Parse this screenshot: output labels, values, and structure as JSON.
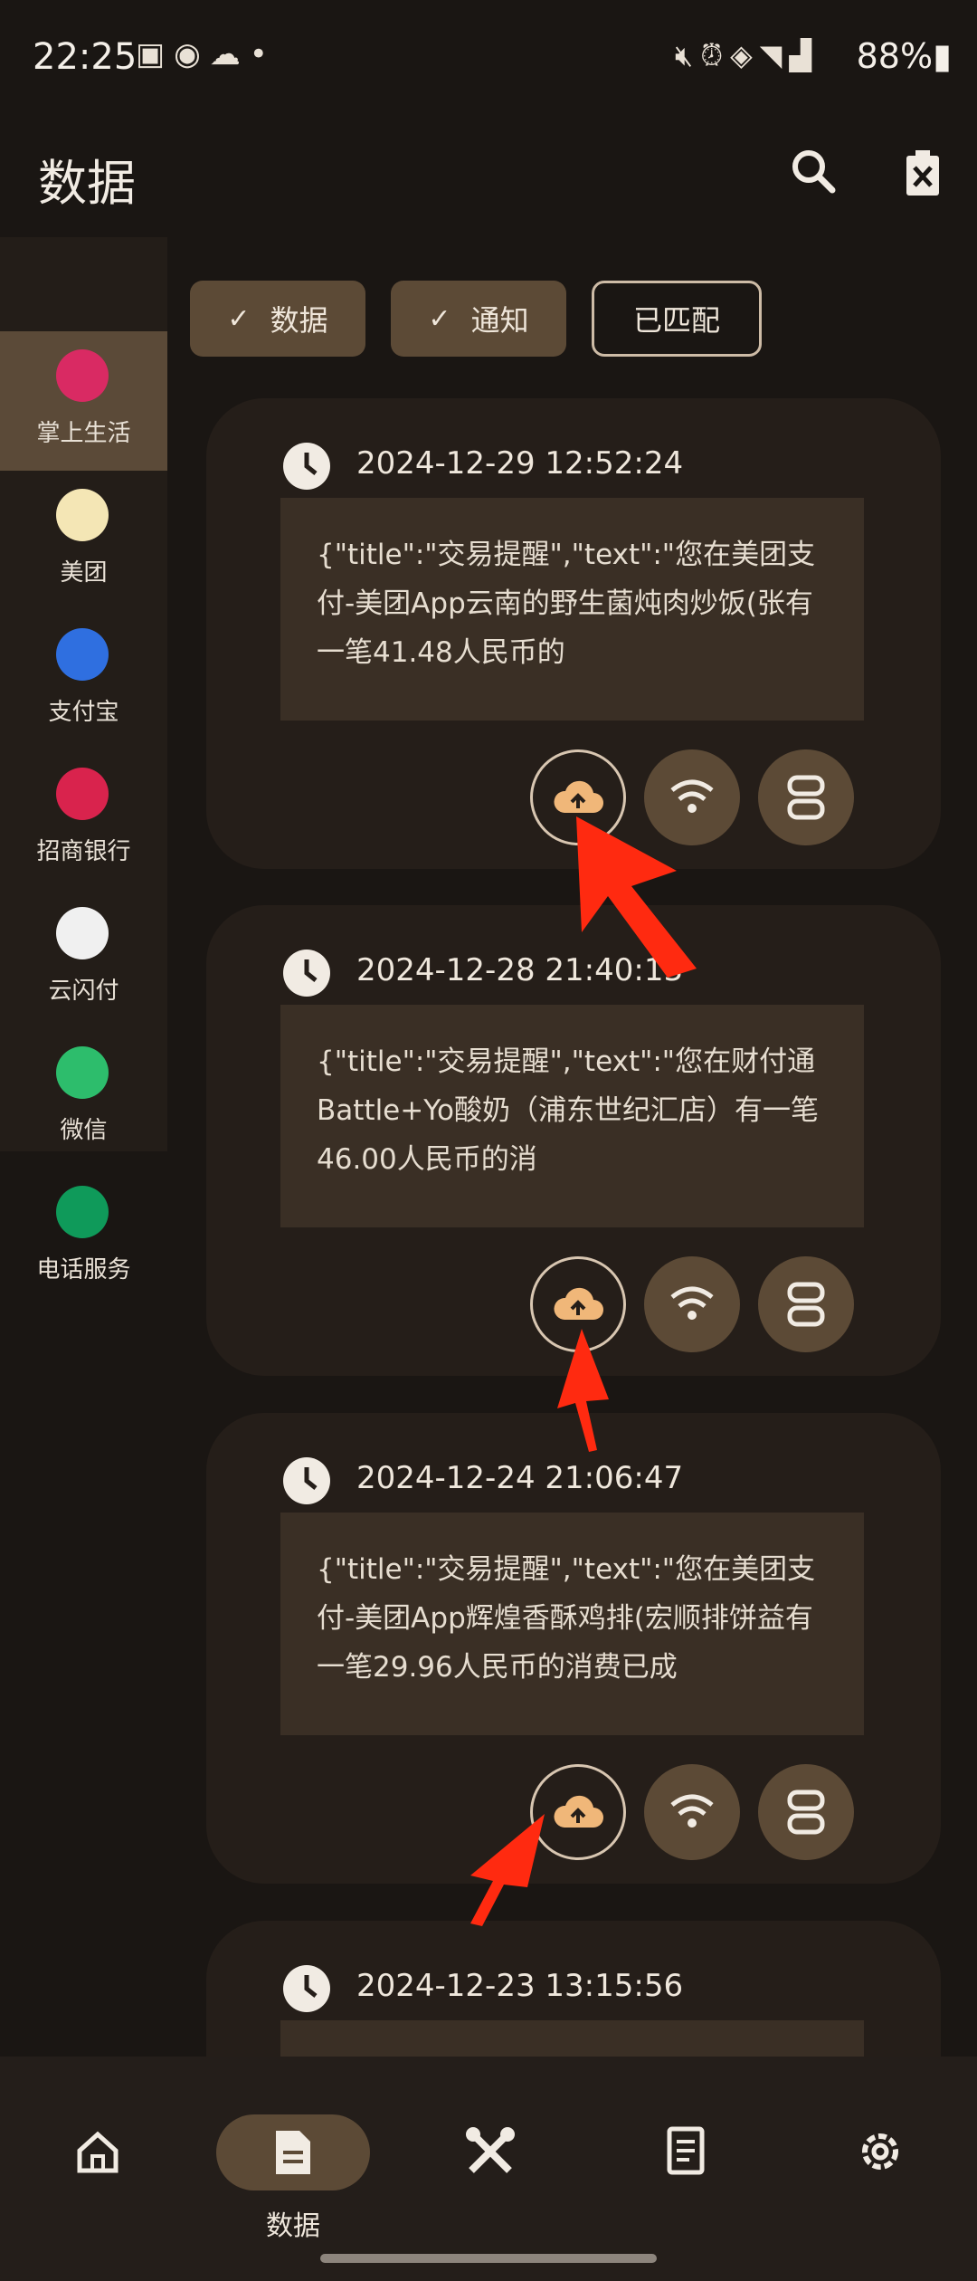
{
  "status_bar": {
    "time": "22:25",
    "battery": "88%",
    "left_icons": [
      "image-icon",
      "app-icon",
      "cloud-icon",
      "dot-icon"
    ],
    "right_icons": [
      "mute-icon",
      "alarm-icon",
      "data-icon",
      "nfc-icon",
      "wifi-icon",
      "signal-icon",
      "signal-icon",
      "battery-icon"
    ]
  },
  "app_bar": {
    "title": "数据",
    "actions": [
      "search-icon",
      "clear-list-icon"
    ]
  },
  "sidebar": {
    "items": [
      {
        "label": "掌上生活",
        "icon": "zhangshang-icon",
        "color": "#d92a63",
        "active": true
      },
      {
        "label": "美团",
        "icon": "meituan-icon",
        "color": "#f4e6b5",
        "active": false
      },
      {
        "label": "支付宝",
        "icon": "alipay-icon",
        "color": "#2f6fe0",
        "active": false
      },
      {
        "label": "招商银行",
        "icon": "cmb-icon",
        "color": "#d9234d",
        "active": false
      },
      {
        "label": "云闪付",
        "icon": "unionpay-icon",
        "color": "#f0f0f0",
        "active": false
      },
      {
        "label": "微信",
        "icon": "wechat-icon",
        "color": "#2dbd6c",
        "active": false
      },
      {
        "label": "电话服务",
        "icon": "phone-service-icon",
        "color": "#0f9a5a",
        "active": false
      }
    ]
  },
  "filters": [
    {
      "label": "数据",
      "checked": true
    },
    {
      "label": "通知",
      "checked": true
    },
    {
      "label": "已匹配",
      "checked": false
    }
  ],
  "records": [
    {
      "time": "2024-12-29 12:52:24",
      "content": "{\"title\":\"交易提醒\",\"text\":\"您在美团支付-美团App云南的野生菌炖肉炒饭(张有一笔41.48人民币的"
    },
    {
      "time": "2024-12-28 21:40:13",
      "content": "{\"title\":\"交易提醒\",\"text\":\"您在财付通 Battle+Yo酸奶（浦东世纪汇店）有一笔46.00人民币的消"
    },
    {
      "time": "2024-12-24 21:06:47",
      "content": "{\"title\":\"交易提醒\",\"text\":\"您在美团支付-美团App辉煌香酥鸡排(宏顺排饼益有一笔29.96人民币的消费已成"
    },
    {
      "time": "2024-12-23 13:15:56",
      "content": ""
    }
  ],
  "bottom_nav": [
    {
      "label": "",
      "icon": "home-icon",
      "active": false
    },
    {
      "label": "数据",
      "icon": "document-icon",
      "active": true
    },
    {
      "label": "",
      "icon": "tools-icon",
      "active": false
    },
    {
      "label": "",
      "icon": "receipt-icon",
      "active": false
    },
    {
      "label": "",
      "icon": "settings-icon",
      "active": false
    }
  ],
  "colors": {
    "background": "#1a1613",
    "card": "#251e19",
    "card_body": "#3a2f25",
    "accent": "#5c4a36",
    "upload_icon": "#f0b779",
    "annotation_arrow": "#ff2a10"
  }
}
